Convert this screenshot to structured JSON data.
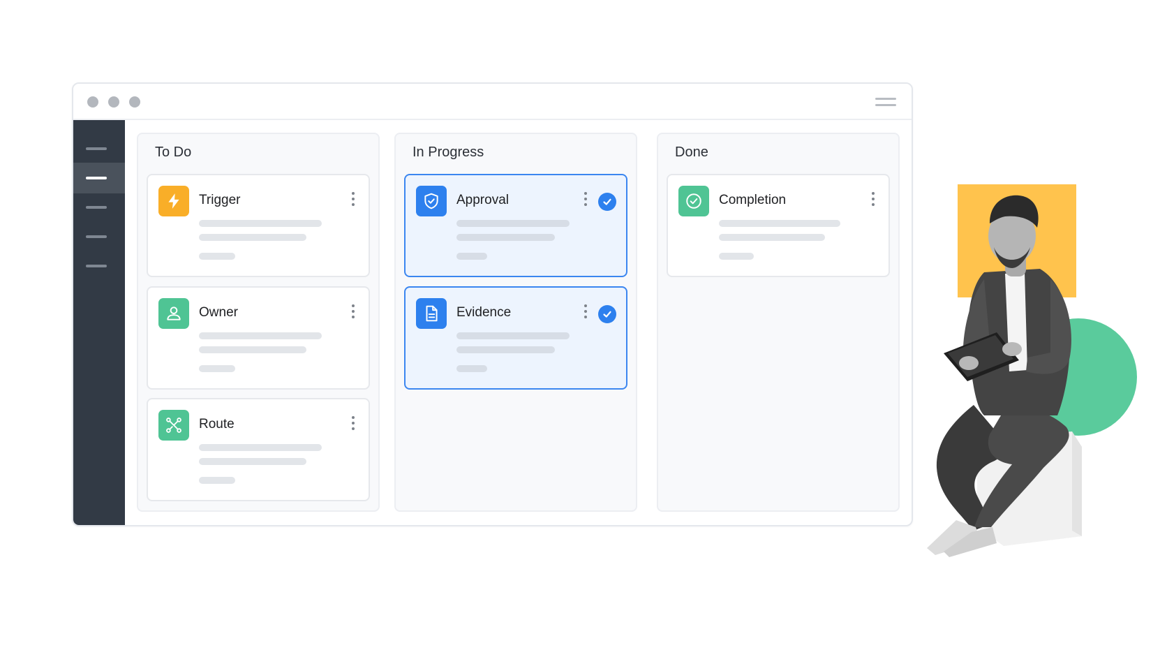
{
  "window": {
    "icons": [
      "window-close-dot",
      "window-minimize-dot",
      "window-maximize-dot",
      "hamburger-menu-icon"
    ]
  },
  "sidebar": {
    "items": [
      {
        "name": "nav-item-1",
        "active": false
      },
      {
        "name": "nav-item-2",
        "active": true
      },
      {
        "name": "nav-item-3",
        "active": false
      },
      {
        "name": "nav-item-4",
        "active": false
      },
      {
        "name": "nav-item-5",
        "active": false
      }
    ]
  },
  "board": {
    "columns": [
      {
        "title": "To Do",
        "cards": [
          {
            "title": "Trigger",
            "icon": "lightning-bolt-icon",
            "color": "#F9AE28",
            "selected": false
          },
          {
            "title": "Owner",
            "icon": "user-icon",
            "color": "#4FC494",
            "selected": false
          },
          {
            "title": "Route",
            "icon": "route-icon",
            "color": "#4FC494",
            "selected": false
          }
        ]
      },
      {
        "title": "In Progress",
        "cards": [
          {
            "title": "Approval",
            "icon": "shield-check-icon",
            "color": "#2D80EE",
            "selected": true
          },
          {
            "title": "Evidence",
            "icon": "document-icon",
            "color": "#2D80EE",
            "selected": true
          }
        ]
      },
      {
        "title": "Done",
        "cards": [
          {
            "title": "Completion",
            "icon": "check-circle-icon",
            "color": "#4FC494",
            "selected": false
          }
        ]
      }
    ]
  },
  "colors": {
    "accent_blue": "#2D80EE",
    "accent_green": "#4FC494",
    "accent_yellow": "#F9AE28",
    "sidebar_bg": "#323A45",
    "backdrop_yellow": "#FFC34D",
    "backdrop_green": "#5ACB9C"
  }
}
